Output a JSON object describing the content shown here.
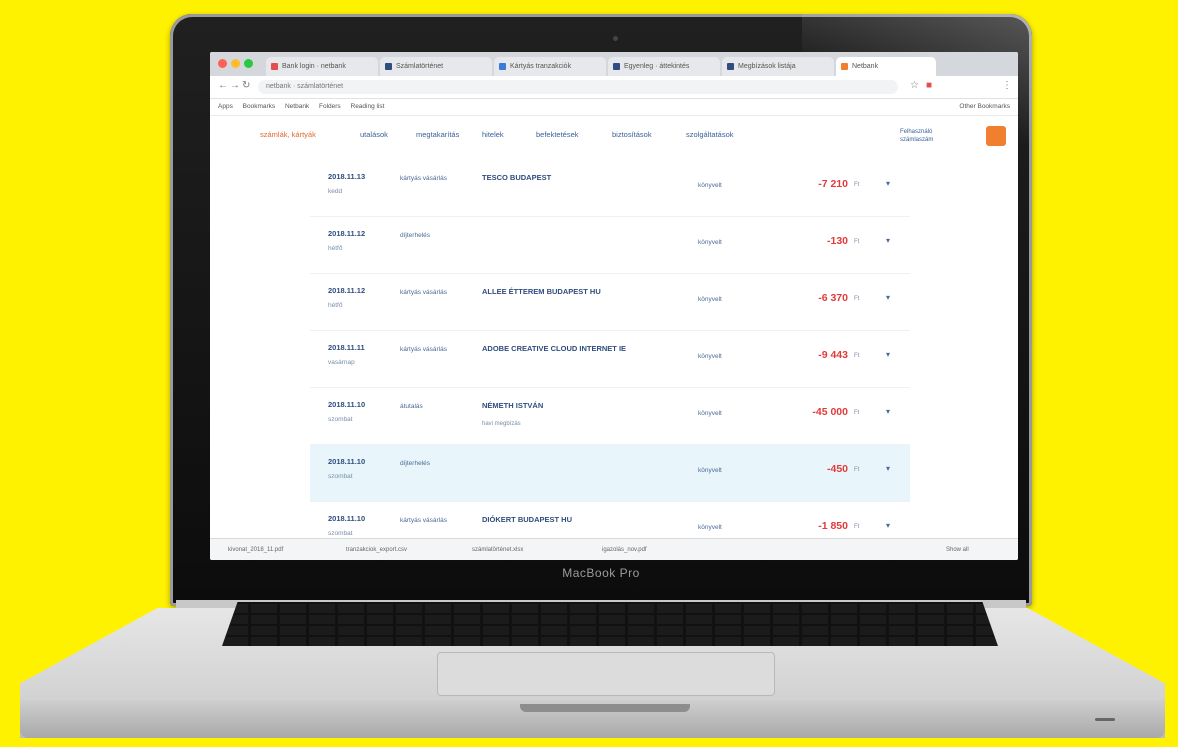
{
  "device": {
    "brand_label": "MacBook Pro"
  },
  "browser": {
    "tabs": [
      {
        "label": "Bank login · netbank",
        "color": "#e05050"
      },
      {
        "label": "Számlatörténet",
        "color": "#2f4d7e"
      },
      {
        "label": "Kártyás tranzakciók",
        "color": "#3a7bd5"
      },
      {
        "label": "Egyenleg · áttekintés",
        "color": "#2f4d7e"
      },
      {
        "label": "Megbízások listája",
        "color": "#2f4d7e"
      },
      {
        "label": "Netbank",
        "color": "#f08030"
      }
    ],
    "url": "netbank · számlatörténet",
    "bookmarks": [
      "Apps",
      "Bookmarks",
      "Netbank",
      "Folders",
      "Reading list",
      "Other Bookmarks"
    ]
  },
  "menu": {
    "items": [
      "számlák, kártyák",
      "utalások",
      "megtakarítás",
      "hitelek",
      "befektetések",
      "biztosítások",
      "szolgáltatások"
    ],
    "user_line1": "Felhasználó",
    "user_line2": "számlaszám"
  },
  "transactions": [
    {
      "date": "2018.11.13",
      "day": "kedd",
      "type": "kártyás vásárlás",
      "merchant": "TESCO BUDAPEST",
      "sub": "",
      "status": "könyvelt",
      "amount": "-7 210",
      "currency": "Ft"
    },
    {
      "date": "2018.11.12",
      "day": "hétfő",
      "type": "díjterhelés",
      "merchant": "",
      "sub": "",
      "status": "könyvelt",
      "amount": "-130",
      "currency": "Ft"
    },
    {
      "date": "2018.11.12",
      "day": "hétfő",
      "type": "kártyás vásárlás",
      "merchant": "ALLEE ÉTTEREM BUDAPEST HU",
      "sub": "",
      "status": "könyvelt",
      "amount": "-6 370",
      "currency": "Ft"
    },
    {
      "date": "2018.11.11",
      "day": "vasárnap",
      "type": "kártyás vásárlás",
      "merchant": "ADOBE CREATIVE CLOUD INTERNET IE",
      "sub": "",
      "status": "könyvelt",
      "amount": "-9 443",
      "currency": "Ft"
    },
    {
      "date": "2018.11.10",
      "day": "szombat",
      "type": "átutalás",
      "merchant": "NÉMETH ISTVÁN",
      "sub": "havi megbízás",
      "status": "könyvelt",
      "amount": "-45 000",
      "currency": "Ft"
    },
    {
      "date": "2018.11.10",
      "day": "szombat",
      "type": "díjterhelés",
      "merchant": "",
      "sub": "",
      "status": "könyvelt",
      "amount": "-450",
      "currency": "Ft"
    },
    {
      "date": "2018.11.10",
      "day": "szombat",
      "type": "kártyás vásárlás",
      "merchant": "DIÓKERT BUDAPEST HU",
      "sub": "",
      "status": "könyvelt",
      "amount": "-1 850",
      "currency": "Ft"
    }
  ],
  "downloads": {
    "items": [
      "kivonat_2018_11.pdf",
      "tranzakciok_export.csv",
      "számlatörténet.xlsx",
      "igazolás_nov.pdf"
    ],
    "show_all": "Show all"
  }
}
